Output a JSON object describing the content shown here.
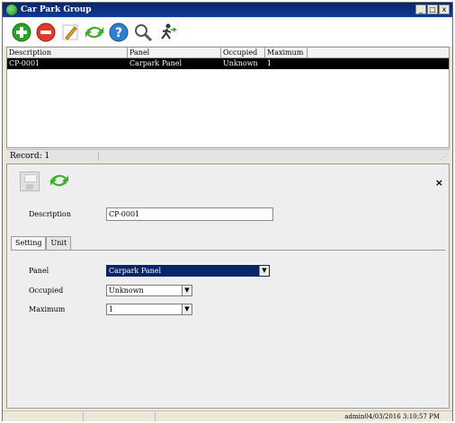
{
  "window": {
    "title": "Car Park Group"
  },
  "toolbar": {
    "icons": [
      "add-icon",
      "delete-icon",
      "edit-icon",
      "refresh-icon",
      "help-icon",
      "search-icon",
      "exit-icon"
    ]
  },
  "grid": {
    "columns": [
      "Description",
      "Panel",
      "Occupied",
      "Maximum"
    ],
    "rows": [
      {
        "description": "CP-0001",
        "panel": "Carpark Panel",
        "occupied": "Unknown",
        "maximum": "1"
      }
    ]
  },
  "record_bar": {
    "text": "Record: 1"
  },
  "detail": {
    "description_label": "Description",
    "description_value": "CP-0001",
    "tabs": [
      "Setting",
      "Unit"
    ],
    "panel_label": "Panel",
    "panel_value": "Carpark Panel",
    "occupied_label": "Occupied",
    "occupied_value": "Unknown",
    "maximum_label": "Maximum",
    "maximum_value": "1"
  },
  "status": {
    "info": "admin04/03/2016 3:10:57 PM"
  },
  "colors": {
    "titlebar": "#0a246a",
    "selection": "#000000"
  }
}
